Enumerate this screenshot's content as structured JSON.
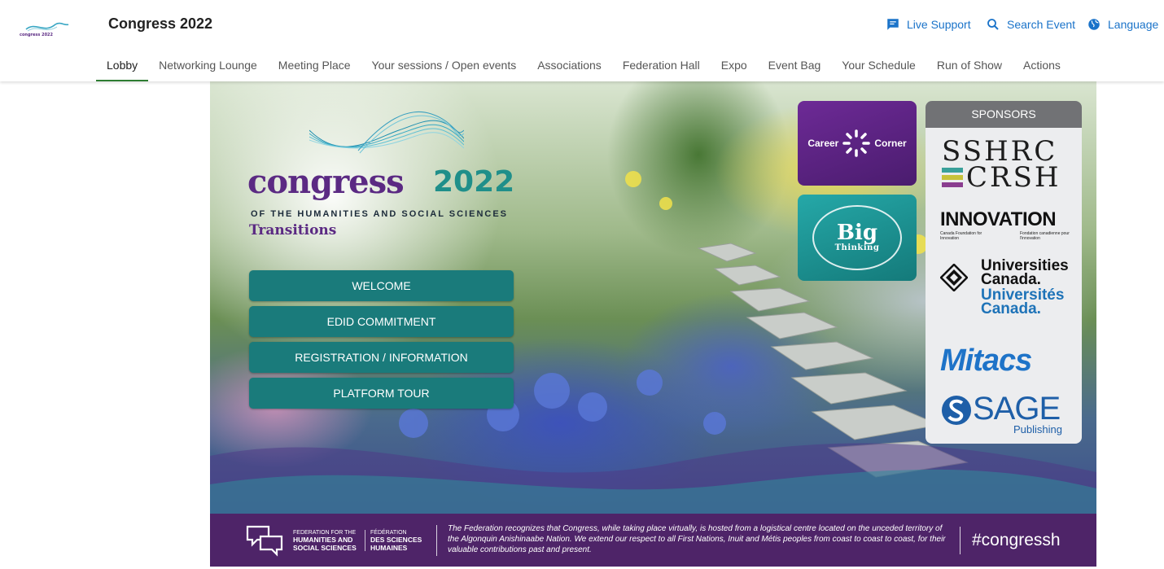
{
  "app": {
    "title": "Congress 2022",
    "logo_text": "congress 2022"
  },
  "header_actions": {
    "live_support": "Live Support",
    "search_event": "Search Event",
    "language": "Language"
  },
  "nav": {
    "tabs": [
      "Lobby",
      "Networking Lounge",
      "Meeting Place",
      "Your sessions / Open events",
      "Associations",
      "Federation Hall",
      "Expo",
      "Event Bag",
      "Your Schedule",
      "Run of Show",
      "Actions"
    ],
    "active": "Lobby"
  },
  "lobby": {
    "logo": {
      "word": "congress",
      "year": "2022",
      "subtitle": "OF THE HUMANITIES AND SOCIAL SCIENCES",
      "theme": "Transitions"
    },
    "buttons": {
      "welcome": "WELCOME",
      "edid": "EDID COMMITMENT",
      "registration": "REGISTRATION / INFORMATION",
      "tour": "PLATFORM TOUR"
    },
    "career_corner": {
      "left": "Career",
      "right": "Corner"
    },
    "big_thinking": {
      "big": "Big",
      "thinking": "Thinking"
    },
    "sponsors": {
      "title": "SPONSORS",
      "sshrc": {
        "line1": "SSHRC",
        "line2": "CRSH",
        "bar_colors": [
          "#3aa09a",
          "#c7c23a",
          "#8a3d8f"
        ]
      },
      "innovation": {
        "name": "INNOVATION",
        "en": "Canada Foundation for Innovation",
        "fr": "Fondation canadienne pour l'innovation",
        "accent": "#d4302b"
      },
      "universities": {
        "en1": "Universities",
        "en2": "Canada.",
        "fr1": "Universités",
        "fr2": "Canada."
      },
      "mitacs": {
        "name": "Mitacs"
      },
      "sage": {
        "name": "SAGE",
        "sub": "Publishing"
      }
    }
  },
  "footer": {
    "fed_en_1": "FEDERATION FOR THE",
    "fed_en_2": "HUMANITIES AND",
    "fed_en_3": "SOCIAL SCIENCES",
    "fed_fr_1": "FÉDÉRATION",
    "fed_fr_2": "DES SCIENCES",
    "fed_fr_3": "HUMAINES",
    "acknowledgement": "The Federation recognizes that Congress, while taking place virtually, is hosted from a logistical centre located on the unceded territory of the Algonquin Anishinaabe Nation. We extend our respect to all First Nations, Inuit and Métis peoples from coast to coast to coast, for their valuable contributions past and present.",
    "hashtag": "#congressh"
  },
  "colors": {
    "accent_blue": "#1a73c9",
    "active_tab_underline": "#2e7d32",
    "button_teal": "#1a7b7b",
    "brand_purple": "#5b2a83",
    "footer_purple": "#4e2468"
  }
}
